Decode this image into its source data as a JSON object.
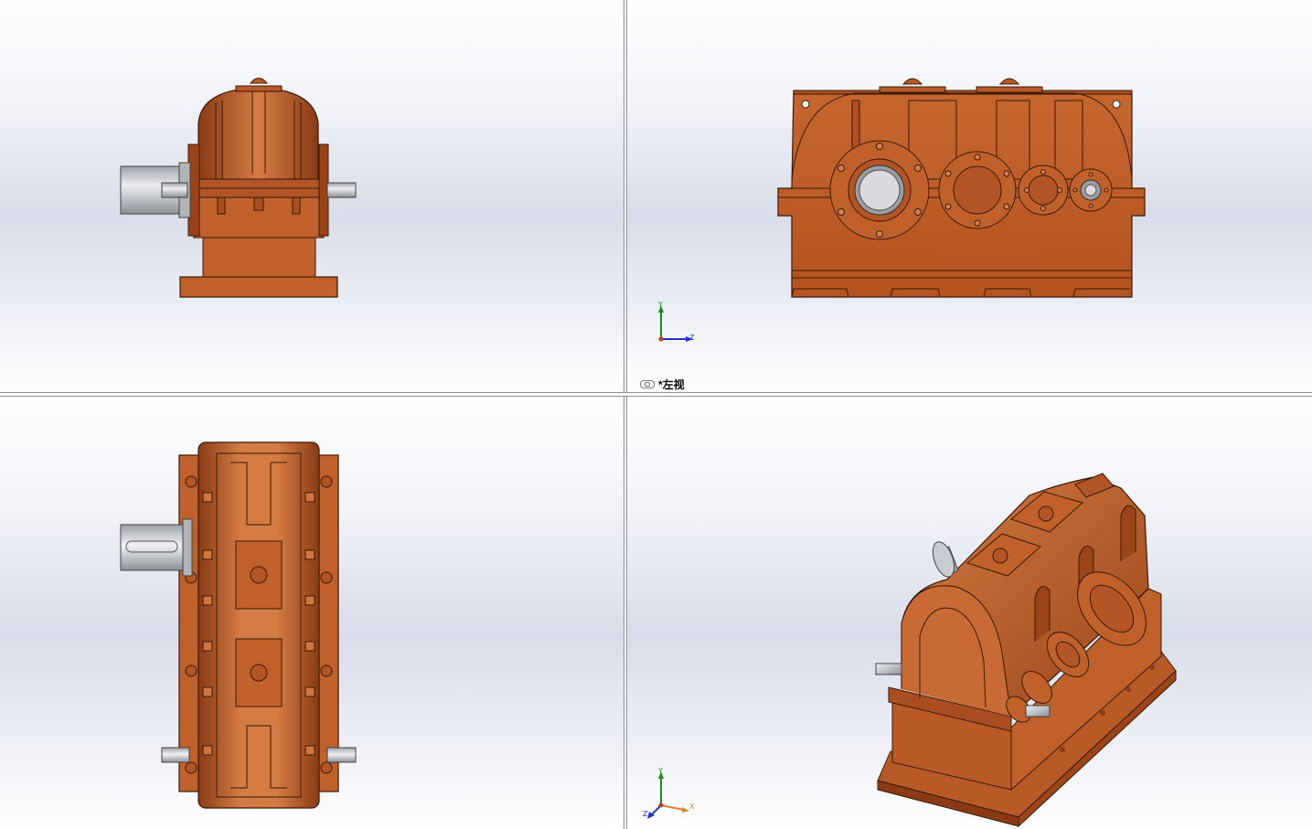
{
  "viewports": {
    "front": {
      "name": "front-view"
    },
    "left": {
      "name": "left-view",
      "label": "*左视",
      "axes": {
        "y": "Y",
        "z": "Z"
      }
    },
    "top": {
      "name": "top-view"
    },
    "iso": {
      "name": "isometric-view",
      "axes": {
        "y": "Y",
        "x": "X",
        "z": "Z"
      }
    }
  },
  "colors": {
    "body": "#c0602a",
    "body_dark": "#7a3512",
    "body_light": "#d8844f",
    "shaft": "#c8cbd0",
    "axis_x": "#c0392b",
    "axis_y": "#1e8c2a",
    "axis_z": "#2233cc"
  }
}
